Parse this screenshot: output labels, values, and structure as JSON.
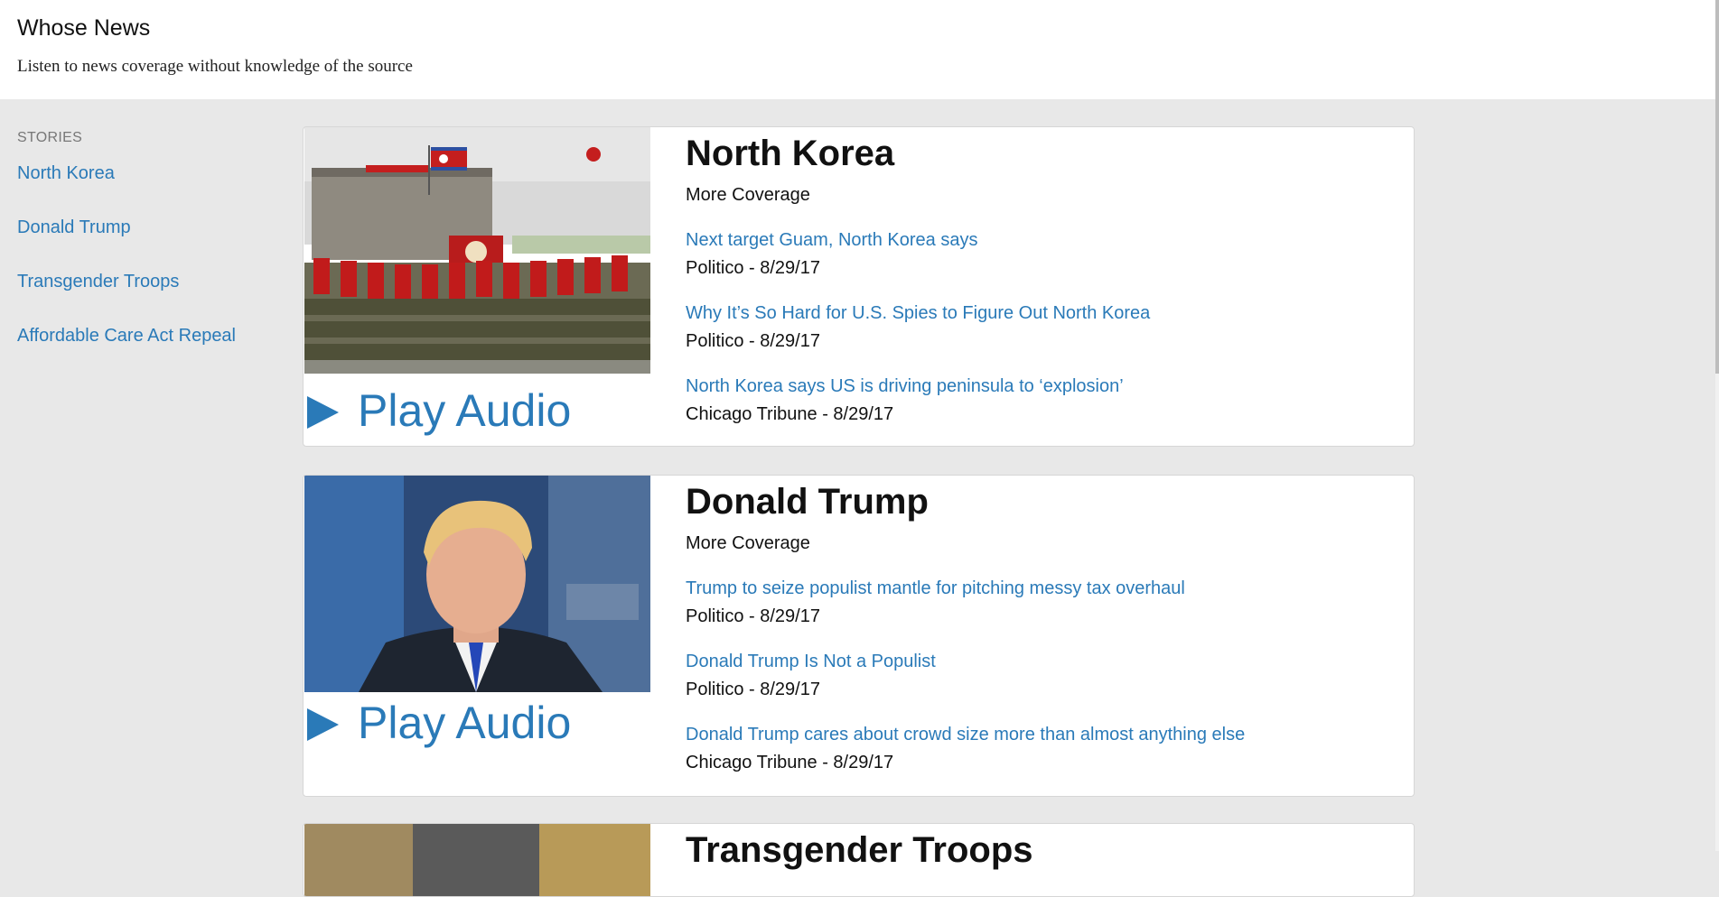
{
  "header": {
    "title": "Whose News",
    "tagline": "Listen to news coverage without knowledge of the source"
  },
  "sidebar": {
    "heading": "STORIES",
    "items": [
      {
        "label": "North Korea"
      },
      {
        "label": "Donald Trump"
      },
      {
        "label": "Transgender Troops"
      },
      {
        "label": "Affordable Care Act Repeal"
      }
    ]
  },
  "stories": [
    {
      "title": "North Korea",
      "more_coverage": "More Coverage",
      "play_label": "Play Audio",
      "articles": [
        {
          "headline": "Next target Guam, North Korea says",
          "source": "Politico - 8/29/17"
        },
        {
          "headline": "Why It’s So Hard for U.S. Spies to Figure Out North Korea",
          "source": "Politico - 8/29/17"
        },
        {
          "headline": "North Korea says US is driving peninsula to ‘explosion’",
          "source": "Chicago Tribune - 8/29/17"
        }
      ]
    },
    {
      "title": "Donald Trump",
      "more_coverage": "More Coverage",
      "play_label": "Play Audio",
      "articles": [
        {
          "headline": "Trump to seize populist mantle for pitching messy tax overhaul",
          "source": "Politico - 8/29/17"
        },
        {
          "headline": "Donald Trump Is Not a Populist",
          "source": "Politico - 8/29/17"
        },
        {
          "headline": "Donald Trump cares about crowd size more than almost anything else",
          "source": "Chicago Tribune - 8/29/17"
        }
      ]
    },
    {
      "title": "Transgender Troops"
    }
  ],
  "colors": {
    "link": "#2a7ab8",
    "page_background": "#e8e8e8"
  }
}
